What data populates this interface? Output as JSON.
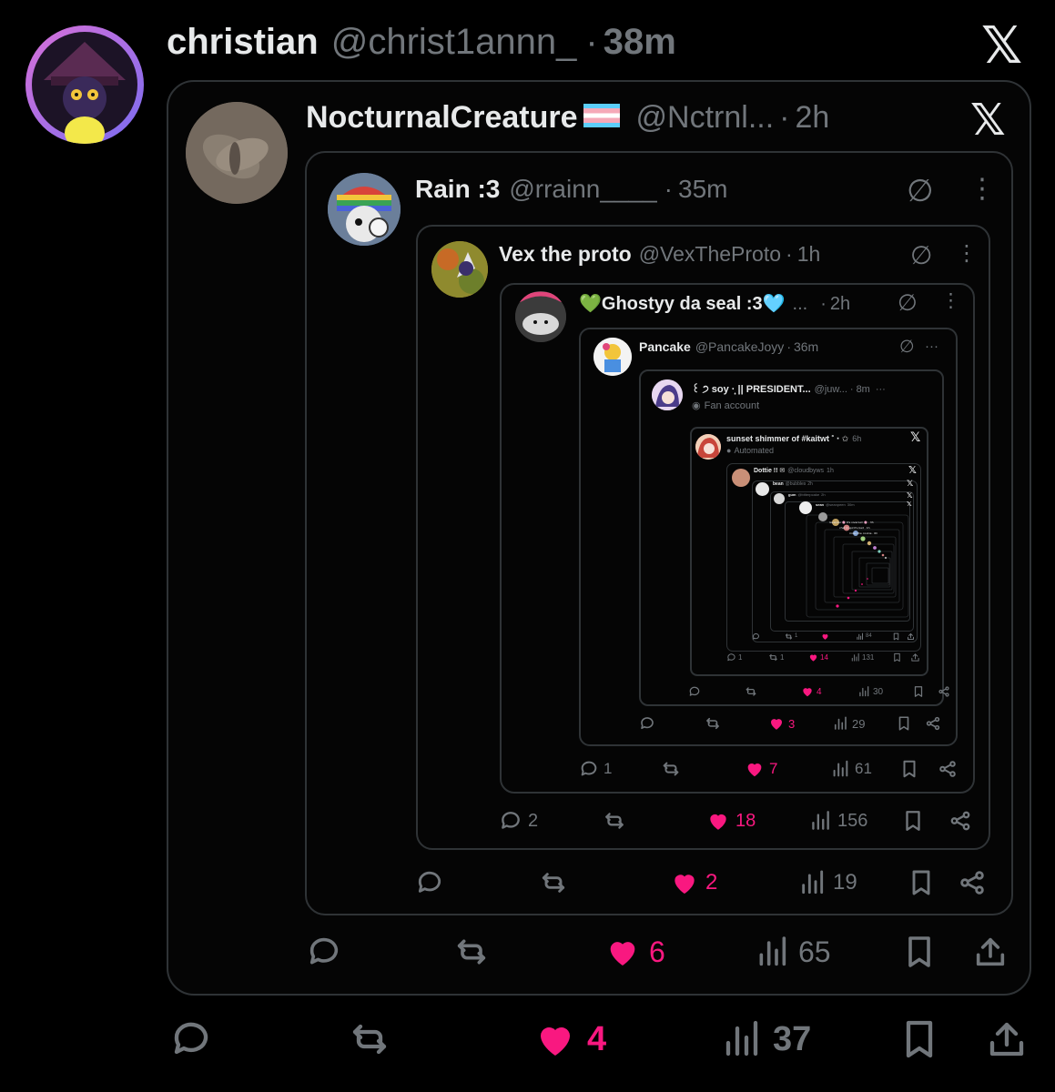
{
  "colors": {
    "background": "#000000",
    "text": "#e7e9ea",
    "muted": "#71767b",
    "like": "#f91880",
    "border": "#2f3336"
  },
  "level0": {
    "name": "christian",
    "handle": "@christ1annn_",
    "time": "38m",
    "source_icon": "x-logo-icon",
    "actions": {
      "replies": "",
      "retweets": "",
      "likes": "4",
      "views": "37"
    }
  },
  "level1": {
    "name": "NocturnalCreature",
    "flag": "🏳️‍⚧️",
    "handle": "@Nctrnl...",
    "time": "2h",
    "source_icon": "x-logo-icon",
    "actions": {
      "replies": "",
      "retweets": "",
      "likes": "6",
      "views": "65"
    }
  },
  "level2": {
    "name": "Rain :3",
    "handle": "@rrainn____",
    "time": "35m",
    "actions": {
      "replies": "",
      "retweets": "",
      "likes": "2",
      "views": "19"
    }
  },
  "level3": {
    "name": "Vex the proto",
    "handle": "@VexTheProto",
    "time": "1h",
    "actions": {
      "replies": "2",
      "retweets": "",
      "likes": "18",
      "views": "156"
    }
  },
  "level4": {
    "name": "💚Ghostyy da seal :3🩵",
    "handle": "...",
    "time": "2h",
    "actions": {
      "replies": "1",
      "retweets": "",
      "likes": "7",
      "views": "61"
    }
  },
  "level5": {
    "name": "Pancake",
    "handle": "@PancakeJoyy",
    "time": "36m",
    "actions": {
      "replies": "",
      "retweets": "",
      "likes": "3",
      "views": "29"
    }
  },
  "level6": {
    "name": "꒰ ੭ soy ·̩͙ || PRESIDENT...",
    "handle": "@juw...",
    "time": "8m",
    "label": "Fan account",
    "actions": {
      "replies": "",
      "retweets": "",
      "likes": "4",
      "views": "30"
    }
  },
  "level7": {
    "name": "sunset shimmer of #kaitwt ˚ ‧ ✩",
    "handle": "",
    "time": "6h",
    "label": "Automated",
    "actions": {
      "replies": "1",
      "retweets": "1",
      "likes": "14",
      "views": "131"
    }
  },
  "level8": {
    "name": "Dottie !! ✉",
    "handle": "@cloudbyws",
    "time": "1h",
    "actions": {
      "replies": "",
      "retweets": "1",
      "likes": "",
      "views": "84"
    }
  },
  "level9": {
    "name": "bean",
    "handle": "@bubbles",
    "time": "2h"
  },
  "level10": {
    "name": "gum",
    "handle": "@bitterpcake",
    "time": "2h"
  },
  "level11": {
    "name": "sean",
    "handle": "@seanpeen",
    "time": "30m"
  }
}
